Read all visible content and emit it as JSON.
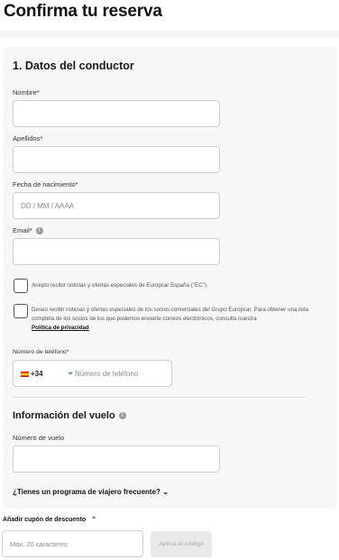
{
  "page": {
    "title": "Confirma tu reserva"
  },
  "driver": {
    "heading": "1. Datos del conductor",
    "name_label": "Nombre*",
    "name_value": "",
    "surname_label": "Apellidos*",
    "surname_value": "",
    "dob_label": "Fecha de nacimiento*",
    "dob_placeholder": "DD / MM / AAAA",
    "email_label": "Email*",
    "email_value": "",
    "consent_ec": "Acepto recibir noticias y ofertas especiales de Europcar España (\"EC\").",
    "consent_partners": "Deseo recibir noticias y ofertas especiales de los socios comerciales del Grupo Europcar. Para obtener una lista completa de los socios de los que podemos enviarte correos electrónicos, consulta nuestra",
    "privacy_link": "Política de privacidad",
    "phone_label": "Número de teléfono*",
    "phone_prefix": "+34",
    "phone_placeholder": "Número de teléfono"
  },
  "flight": {
    "heading": "Información del vuelo",
    "number_label": "Número de vuelo",
    "number_value": "",
    "frequent_flyer": "¿Tienes un programa de viajero frecuente?"
  },
  "coupon": {
    "toggle_label": "Añadir cupón de descuento",
    "placeholder": "Max. 20 caracteres",
    "apply_label": "Aplica el código"
  },
  "icons": {
    "info": "info-icon",
    "flag": "spain-flag-icon",
    "chevron_down": "chevron-down-icon",
    "chevron_up": "chevron-up-icon"
  },
  "colors": {
    "phone_chevron": "#2a9d3a",
    "card_bg": "#f7f7f7"
  }
}
